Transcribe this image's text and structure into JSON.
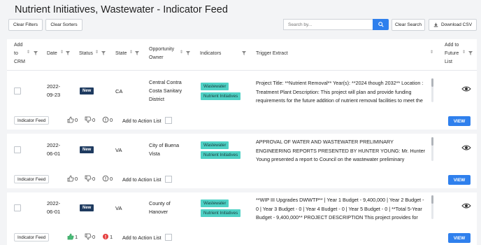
{
  "page": {
    "title": "Nutrient Initiatives, Wastewater - Indicator Feed"
  },
  "toolbar": {
    "clear_filters": "Clear Filters",
    "clear_sorters": "Clear Sorters",
    "search_placeholder": "Search by...",
    "clear_search": "Clear Search",
    "download_csv": "Download CSV"
  },
  "columns": {
    "add_to_crm": [
      "Add",
      "to",
      "CRM"
    ],
    "date": "Date",
    "status": "Status",
    "state": "State",
    "owner": [
      "Opportunity",
      "Owner"
    ],
    "indicators": "Indicators",
    "extract": "Trigger Extract",
    "future": [
      "Add to",
      "Future",
      "List"
    ]
  },
  "rows": [
    {
      "date": [
        "2022-",
        "09-23"
      ],
      "status": "New",
      "state": "CA",
      "owner": [
        "Central Contra",
        "Costa Sanitary",
        "District"
      ],
      "tags": [
        "Wastewater",
        "Nutrient Initiatives"
      ],
      "extract": "Project Title: **Nutrient Removal** Year(s): **2024 though 2032** Location : Treatment Plant Description: This project will plan and provide funding requirements for the future addition of nutrient removal facilities to meet the",
      "feed_tag": "Indicator Feed",
      "likes": "0",
      "dislikes": "0",
      "flags": "0",
      "action_list": "Add to Action List",
      "view": "VIEW"
    },
    {
      "date": [
        "2022-",
        "06-01"
      ],
      "status": "New",
      "state": "VA",
      "owner": [
        "City of Buena",
        "Vista"
      ],
      "tags": [
        "Wastewater",
        "Nutrient Initiatives"
      ],
      "extract": "APPROVAL OF WATER AND WASTEWATER PRELIMINARY ENGINEERING REPORTS PRESENTED BY HUNTER YOUNG: Mr. Hunter Young presented a report to Council on the wastewater preliminary engineering report... **He then",
      "feed_tag": "Indicator Feed",
      "likes": "0",
      "dislikes": "0",
      "flags": "0",
      "action_list": "Add to Action List",
      "view": "VIEW"
    },
    {
      "date": [
        "2022-",
        "06-01"
      ],
      "status": "New",
      "state": "VA",
      "owner": [
        "County of",
        "Hanover"
      ],
      "tags": [
        "Wastewater",
        "Nutrient Initiatives"
      ],
      "extract": "**WIP III Upgrades DWWTP** | Year 1 Budget - 9,400,000 | Year 2 Budget - 0 | Year 3 Budget - 0 | Year 4 Budget - 0 | Year 5 Budget - 0 | **Total 5-Year Budget - 9,400,000** PROJECT DESCRIPTION This project provides for improvements",
      "feed_tag": "Indicator Feed",
      "likes": "1",
      "dislikes": "0",
      "flags": "1",
      "action_list": "Add to Action List",
      "view": "VIEW"
    }
  ],
  "colors": {
    "accent": "#2f80ed",
    "tag": "#4fd1c5",
    "badge": "#1e3a5f",
    "like_active": "#48bb78",
    "flag_active": "#e53e3e"
  },
  "icons": {
    "search": "search-icon",
    "download": "download-icon",
    "sort": "sort-icon",
    "filter": "filter-icon",
    "eye": "eye-icon",
    "thumbs_up": "thumbs-up-icon",
    "thumbs_down": "thumbs-down-icon",
    "flag": "flag-icon"
  }
}
